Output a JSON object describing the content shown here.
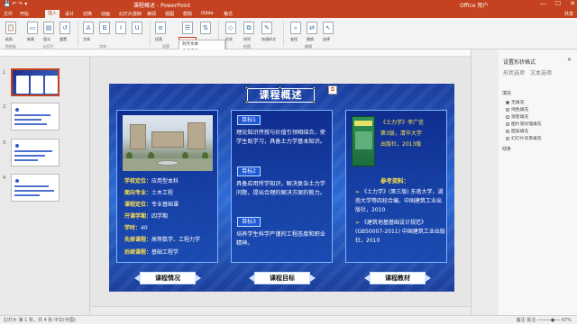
{
  "window": {
    "doc_title": "课程概述 - PowerPoint",
    "user": "Office 用户"
  },
  "ribbon": {
    "tabs": [
      "文件",
      "开始",
      "插入",
      "设计",
      "切换",
      "动画",
      "幻灯片放映",
      "审阅",
      "视图",
      "帮助",
      "iSlide",
      "格式"
    ],
    "active_tab": "开始",
    "share": "共享",
    "buttons": [
      "粘贴",
      "新建",
      "版式",
      "重置",
      "节",
      "字体",
      "段落",
      "文字方向",
      "对齐",
      "形状",
      "排列",
      "快速样式",
      "查找",
      "替换",
      "选择"
    ],
    "groups": [
      "剪贴板",
      "幻灯片",
      "字体",
      "段落",
      "绘图",
      "编辑"
    ],
    "dropdown": [
      "对齐文本",
      "更多选项..."
    ]
  },
  "slides_panel": {
    "numbers": [
      "1",
      "2",
      "3",
      "4"
    ]
  },
  "slide": {
    "title": "课程概述",
    "left": {
      "rows": [
        {
          "k": "学校定位：",
          "v": "应用型本科"
        },
        {
          "k": "面向专业：",
          "v": "土木工程"
        },
        {
          "k": "课程定位：",
          "v": "专业基础课"
        },
        {
          "k": "开课学期：",
          "v": "四学期"
        },
        {
          "k": "学时：",
          "v": "40"
        },
        {
          "k": "先修课程：",
          "v": "高等数学、工程力学"
        },
        {
          "k": "后续课程：",
          "v": "基础工程学"
        }
      ],
      "pill": "课程情况"
    },
    "middle": {
      "badge1": "目标1",
      "text1": "理论知识传授与价值引领相结合，使学生既学习，具备土力学基本知识。",
      "badge2": "目标2",
      "text2": "具备应用所学知识，解决复杂土力学问题，提出合理的解决方案的能力。",
      "badge3": "目标3",
      "text3": "培养学生科学严谨的工程态度和职业精神。",
      "pill": "课程目标"
    },
    "right": {
      "book_rows": [
        "《土力学》李广信",
        "第3版，清华大学",
        "出版社，2013版"
      ],
      "ref_head": "参考资料：",
      "refs": [
        "《土力学》(第三版) 东南大学，湖南大学等四校合编，中国建筑工业出版社，2010",
        "《建筑地基基础设计规范》(GB50007-2011) 中国建筑工业出版社，2010"
      ],
      "pill": "课程教材"
    }
  },
  "format_pane": {
    "title": "设置形状格式",
    "tabs": [
      "形状选项",
      "文本选项"
    ],
    "section_fill": "填充",
    "options": [
      "无填充",
      "纯色填充",
      "渐变填充",
      "图片或纹理填充",
      "图案填充",
      "幻灯片背景填充"
    ],
    "section_line": "线条"
  },
  "status": {
    "left": "幻灯片 第 1 张，共 4 张  中文(中国)",
    "right": "备注  批注  ─────●──  67%"
  }
}
